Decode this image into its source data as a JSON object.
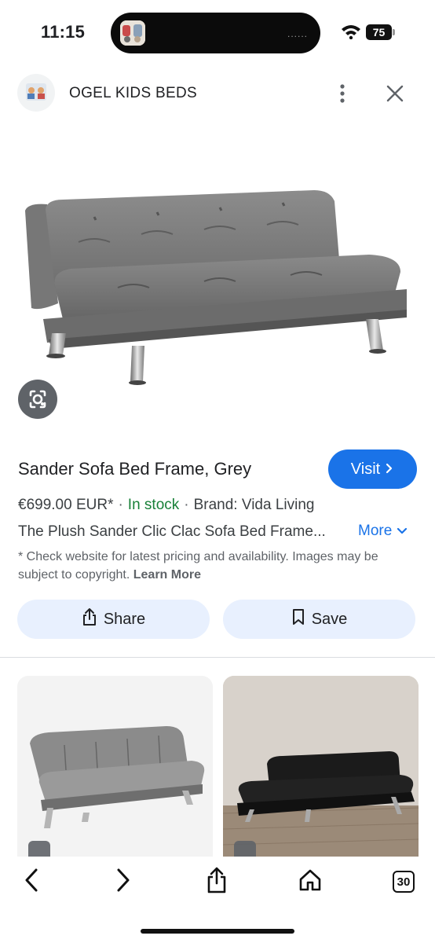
{
  "status_bar": {
    "time": "11:15",
    "battery": "75",
    "island_dots": "......"
  },
  "header": {
    "site_name": "OGEL KIDS BEDS",
    "icons": [
      "site-avatar",
      "more-vert-icon",
      "close-icon"
    ]
  },
  "product": {
    "title": "Sander Sofa Bed Frame, Grey",
    "visit_label": "Visit",
    "price": "€699.00 EUR*",
    "separator": "·",
    "stock": "In stock",
    "brand": "Brand: Vida Living",
    "description": "The Plush Sander Clic Clac Sofa Bed Frame...",
    "more_label": "More",
    "note_text": "* Check website for latest pricing and availability. Images may be subject to copyright.",
    "learn_more": "Learn More"
  },
  "actions": {
    "share_label": "Share",
    "save_label": "Save"
  },
  "bottom_bar": {
    "tabs_count": "30",
    "icons": [
      "back-icon",
      "forward-icon",
      "share-icon",
      "home-icon",
      "tabs-icon"
    ]
  },
  "colors": {
    "accent": "#1a73e8",
    "stock_green": "#188038",
    "tonal_button": "#e8f0fe"
  }
}
